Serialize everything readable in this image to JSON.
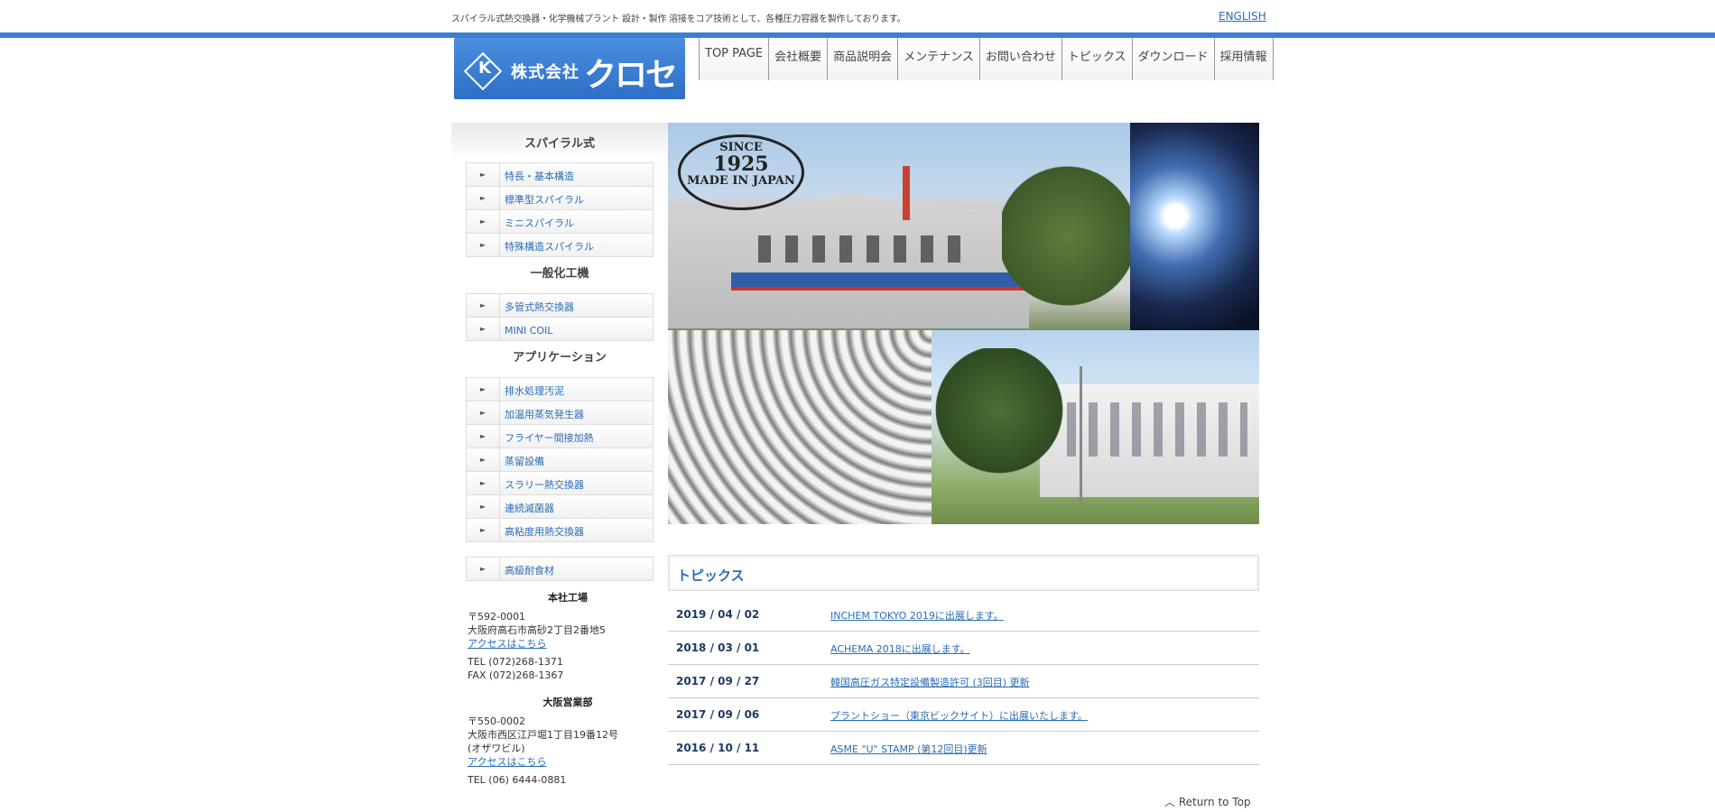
{
  "header": {
    "tagline": "スパイラル式熱交換器・化学機械プラント 設計・製作 溶接をコア技術として、各種圧力容器を製作しております。",
    "english_link": "ENGLISH",
    "logo": {
      "mark": "K",
      "company": "株式会社",
      "name": "クロセ"
    }
  },
  "nav": [
    "TOP PAGE",
    "会社概要",
    "商品説明会",
    "メンテナンス",
    "お問い合わせ",
    "トピックス",
    "ダウンロード",
    "採用情報"
  ],
  "sidebar": {
    "sections": [
      {
        "title": "スパイラル式",
        "items": [
          "特長・基本構造",
          "標準型スパイラル",
          "ミニスパイラル",
          "特殊構造スパイラル"
        ]
      },
      {
        "title": "一般化工機",
        "items": [
          "多管式熱交換器",
          "MINI COIL"
        ]
      },
      {
        "title": "アプリケーション",
        "items": [
          "排水処理汚泥",
          "加温用蒸気発生器",
          "フライヤー間接加熱",
          "蒸留設備",
          "スラリー熱交換器",
          "連続滅菌器",
          "高粘度用熱交換器"
        ]
      }
    ],
    "extra_item": "高級耐食材",
    "arrow": "►",
    "addresses": [
      {
        "heading": "本社工場",
        "postal": "〒592-0001",
        "address": "大阪府高石市高砂2丁目2番地5",
        "access": "アクセスはこちら",
        "tel": "TEL (072)268-1371",
        "fax": "FAX (072)268-1367"
      },
      {
        "heading": "大阪営業部",
        "postal": "〒550-0002",
        "address": "大阪市西区江戸堀1丁目19番12号",
        "building": "(オザワビル)",
        "access": "アクセスはこちら",
        "tel": "TEL (06) 6444-0881"
      }
    ]
  },
  "hero": {
    "stamp_top": "SINCE",
    "stamp_year": "1925",
    "stamp_bottom": "MADE IN JAPAN"
  },
  "topics": {
    "title": "トピックス",
    "items": [
      {
        "date": "2019 / 04 / 02",
        "text": "INCHEM TOKYO 2019に出展します。"
      },
      {
        "date": "2018 / 03 / 01",
        "text": "ACHEMA 2018に出展します。"
      },
      {
        "date": "2017 / 09 / 27",
        "text": "韓国高圧ガス特定設備製造許可 (3回目) 更新"
      },
      {
        "date": "2017 / 09 / 06",
        "text": "プラントショー（東京ビックサイト）に出展いたします。"
      },
      {
        "date": "2016 / 10 / 11",
        "text": "ASME \"U\" STAMP (第12回目)更新"
      }
    ]
  },
  "footer": {
    "return_top": "︿ Return to Top"
  },
  "colors": {
    "accent": "#3b7fd1",
    "link": "#2a6db5"
  }
}
